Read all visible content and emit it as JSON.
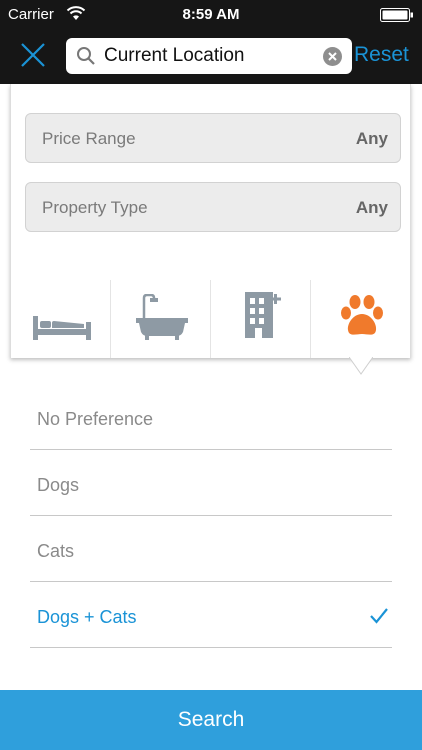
{
  "status_bar": {
    "carrier": "Carrier",
    "time": "8:59 AM"
  },
  "header": {
    "search_value": "Current Location",
    "reset_label": "Reset"
  },
  "filters": {
    "price": {
      "label": "Price Range",
      "value": "Any"
    },
    "property_type": {
      "label": "Property Type",
      "value": "Any"
    }
  },
  "category_tabs": [
    {
      "icon": "bed-icon",
      "active": false
    },
    {
      "icon": "bathtub-icon",
      "active": false
    },
    {
      "icon": "building-icon",
      "active": false
    },
    {
      "icon": "paw-icon",
      "active": true
    }
  ],
  "pet_options": [
    {
      "label": "No Preference",
      "selected": false
    },
    {
      "label": "Dogs",
      "selected": false
    },
    {
      "label": "Cats",
      "selected": false
    },
    {
      "label": "Dogs + Cats",
      "selected": true
    }
  ],
  "search_button_label": "Search",
  "colors": {
    "accent": "#1a93d6",
    "button": "#2f9fdc",
    "active_icon": "#f07a2c",
    "icon_gray": "#8e9aa4"
  }
}
